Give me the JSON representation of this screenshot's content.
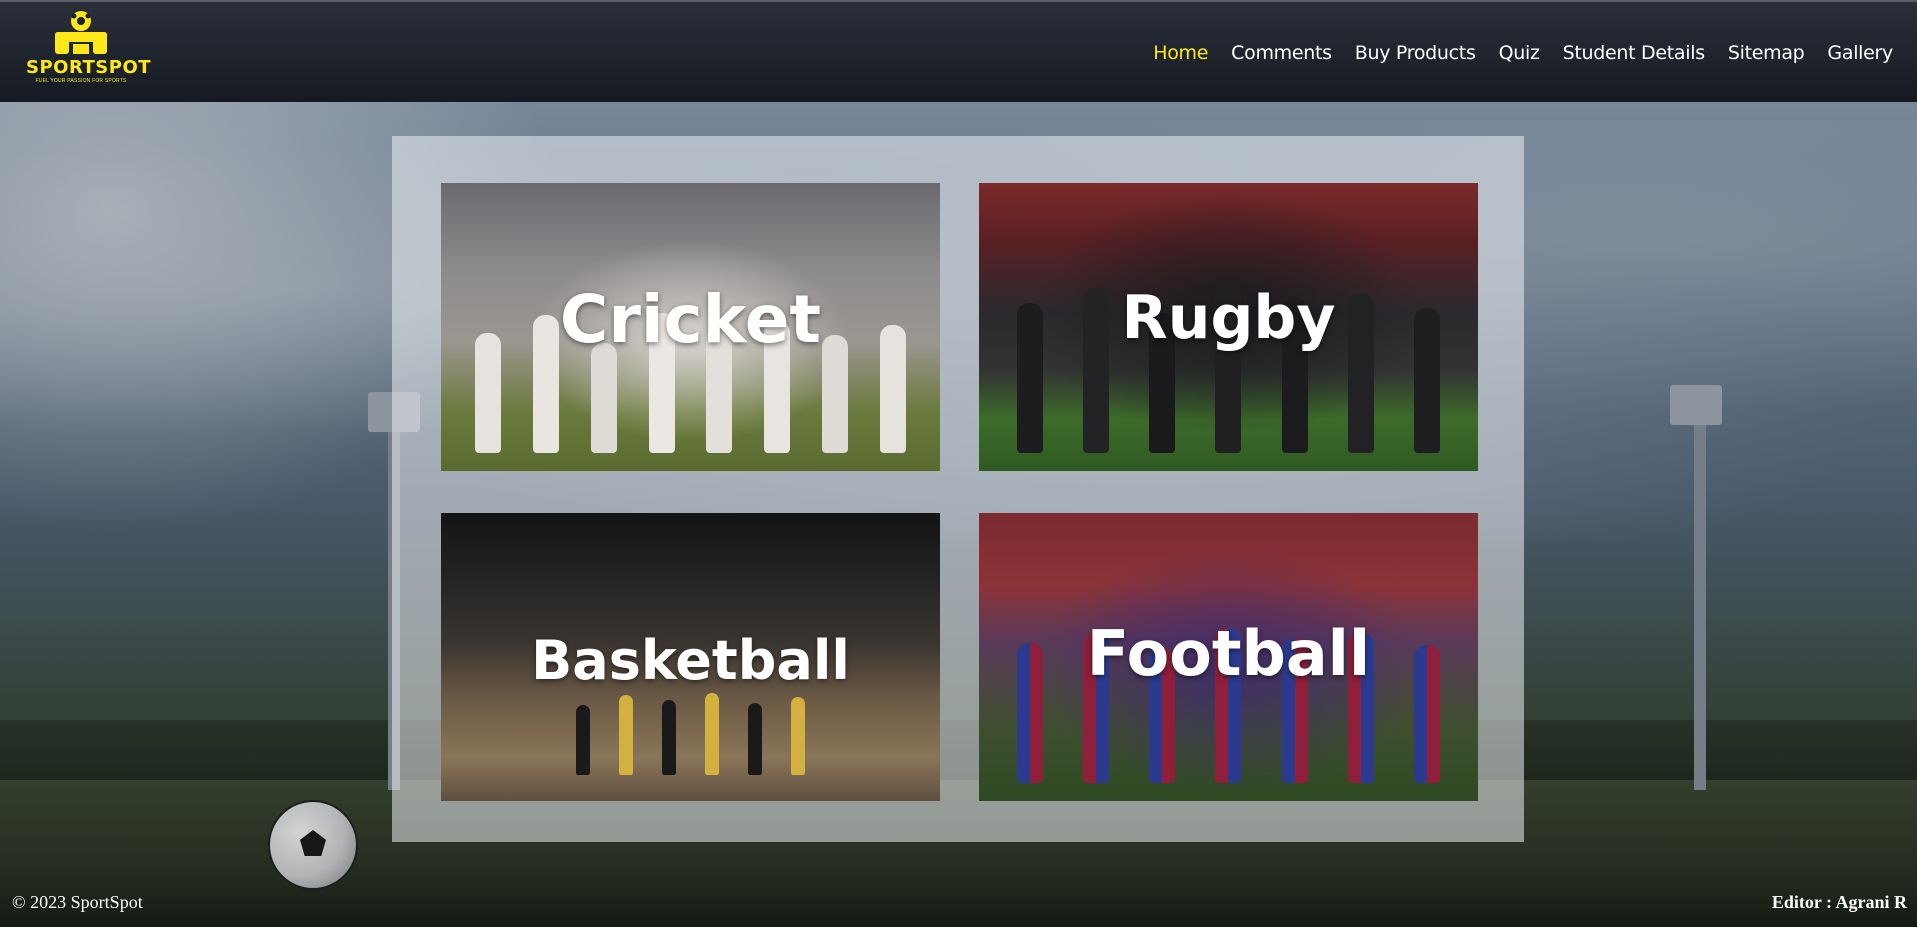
{
  "brand": {
    "name": "SPORTSPOT",
    "tagline": "FUEL YOUR PASSION FOR SPORTS",
    "color": "#ffe81a"
  },
  "nav": {
    "items": [
      {
        "label": "Home",
        "active": true
      },
      {
        "label": "Comments",
        "active": false
      },
      {
        "label": "Buy Products",
        "active": false
      },
      {
        "label": "Quiz",
        "active": false
      },
      {
        "label": "Student Details",
        "active": false
      },
      {
        "label": "Sitemap",
        "active": false
      },
      {
        "label": "Gallery",
        "active": false
      }
    ]
  },
  "cards": [
    {
      "label": "Cricket"
    },
    {
      "label": "Rugby"
    },
    {
      "label": "Basketball"
    },
    {
      "label": "Football"
    }
  ],
  "footer": {
    "copyright": "© 2023 SportSpot",
    "editor": "Editor : Agrani R"
  }
}
